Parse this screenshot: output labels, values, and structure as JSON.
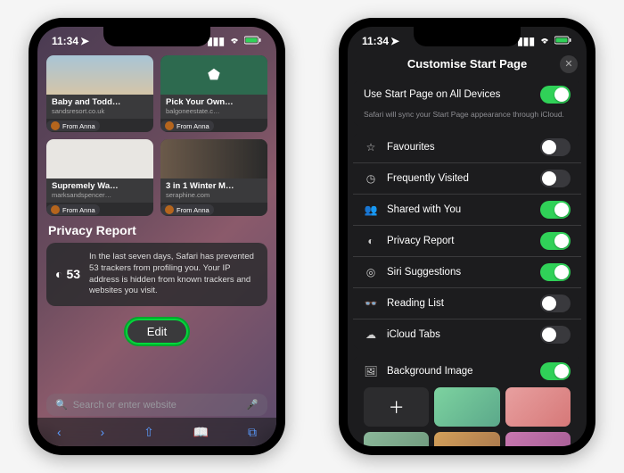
{
  "status": {
    "time": "11:34",
    "location_arrow": "↗"
  },
  "left": {
    "cards": [
      {
        "title": "Baby and Todd…",
        "subtitle": "sandsresort.co.uk",
        "from": "From Anna"
      },
      {
        "title": "Pick Your Own…",
        "subtitle": "balgoneestate.c…",
        "from": "From Anna"
      },
      {
        "title": "Supremely Wa…",
        "subtitle": "marksandspencer…",
        "from": "From Anna"
      },
      {
        "title": "3 in 1 Winter M…",
        "subtitle": "seraphine.com",
        "from": "From Anna"
      }
    ],
    "privacy": {
      "heading": "Privacy Report",
      "count": "53",
      "body": "In the last seven days, Safari has prevented 53 trackers from profiling you. Your IP address is hidden from known trackers and websites you visit."
    },
    "edit_label": "Edit",
    "search_placeholder": "Search or enter website"
  },
  "right": {
    "title": "Customise Start Page",
    "all_devices": {
      "label": "Use Start Page on All Devices",
      "on": true
    },
    "hint": "Safari will sync your Start Page appearance through iCloud.",
    "options": [
      {
        "icon": "star",
        "label": "Favourites",
        "on": false
      },
      {
        "icon": "clock",
        "label": "Frequently Visited",
        "on": false
      },
      {
        "icon": "people",
        "label": "Shared with You",
        "on": true
      },
      {
        "icon": "shield",
        "label": "Privacy Report",
        "on": true
      },
      {
        "icon": "siri",
        "label": "Siri Suggestions",
        "on": true
      },
      {
        "icon": "glasses",
        "label": "Reading List",
        "on": false
      },
      {
        "icon": "cloud",
        "label": "iCloud Tabs",
        "on": false
      }
    ],
    "background": {
      "label": "Background Image",
      "on": true
    }
  }
}
